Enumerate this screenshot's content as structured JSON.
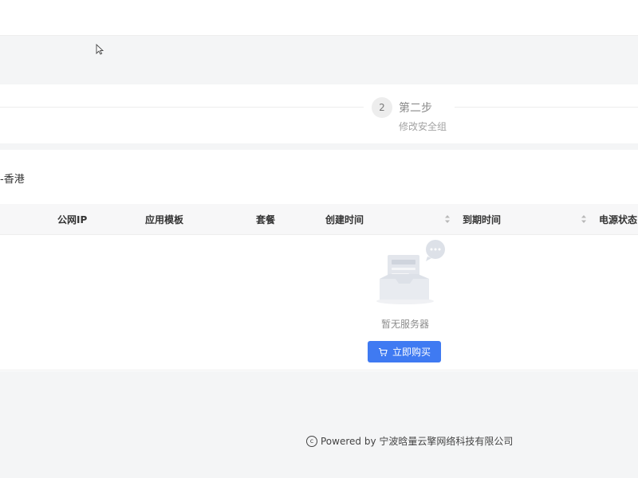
{
  "steps": {
    "step2": {
      "number": "2",
      "title": "第二步",
      "description": "修改安全组"
    }
  },
  "region": {
    "label": "-香港"
  },
  "table": {
    "columns": [
      "公网IP",
      "应用模板",
      "套餐",
      "创建时间",
      "到期时间",
      "电源状态"
    ]
  },
  "empty": {
    "text": "暂无服务器",
    "buy_label": "立即购买"
  },
  "footer": {
    "powered": "Powered by 宁波晗量云擎网络科技有限公司"
  },
  "colors": {
    "primary": "#3f7af2"
  }
}
